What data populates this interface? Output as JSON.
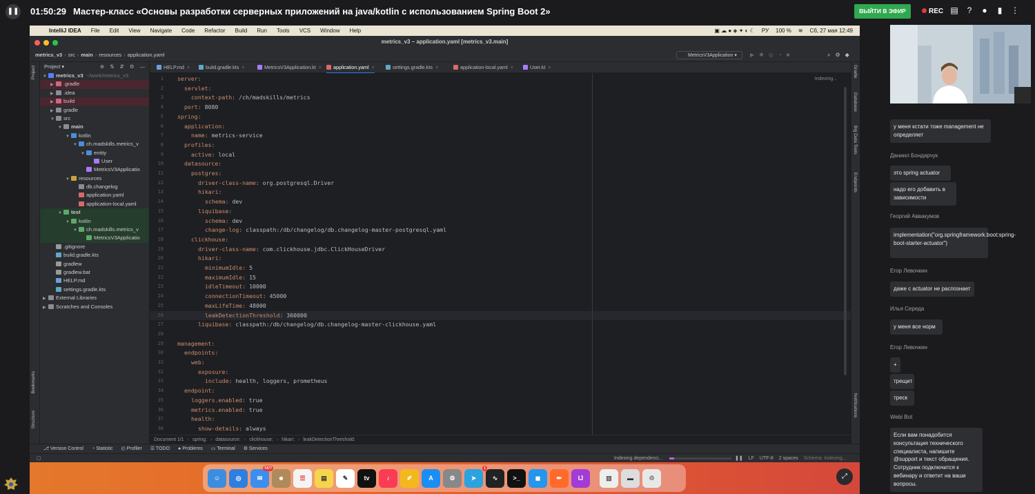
{
  "top_bar": {
    "timer": "01:50:29",
    "title": "Мастер-класс «Основы разработки серверных приложений на java/kotlin с использованием Spring Boot 2»",
    "exit_button": "ВЫЙТИ В ЭФИР",
    "rec_label": "REC",
    "icons": [
      "chat-icon",
      "question-icon",
      "user-icon",
      "document-icon",
      "more-icon"
    ]
  },
  "mac_menu": {
    "items": [
      "IntelliJ IDEA",
      "File",
      "Edit",
      "View",
      "Navigate",
      "Code",
      "Refactor",
      "Build",
      "Run",
      "Tools",
      "VCS",
      "Window",
      "Help"
    ],
    "language": "РУ",
    "battery": "100 %",
    "clock": "Сб, 27 мая  12:49"
  },
  "ide": {
    "window_title": "metrics_v3 – application.yaml [metrics_v3.main]",
    "breadcrumbs": [
      "metrics_v3",
      "src",
      "main",
      "resources",
      "application.yaml"
    ],
    "run_config": "MetricsV3Application",
    "project_panel_title": "Project",
    "tree": [
      {
        "label": "metrics_v3",
        "extra": "~/work/metrics_v3",
        "depth": 0,
        "open": true,
        "bold": true,
        "type": "module"
      },
      {
        "label": ".gradle",
        "depth": 1,
        "open": false,
        "type": "folder-ex"
      },
      {
        "label": ".idea",
        "depth": 1,
        "open": false,
        "type": "folder"
      },
      {
        "label": "build",
        "depth": 1,
        "open": false,
        "type": "folder-ex"
      },
      {
        "label": "gradle",
        "depth": 1,
        "open": false,
        "type": "folder"
      },
      {
        "label": "src",
        "depth": 1,
        "open": true,
        "type": "folder"
      },
      {
        "label": "main",
        "depth": 2,
        "open": true,
        "bold": true,
        "type": "folder"
      },
      {
        "label": "kotlin",
        "depth": 3,
        "open": true,
        "type": "src"
      },
      {
        "label": "ch.madskills.metrics_v",
        "depth": 4,
        "open": true,
        "type": "package"
      },
      {
        "label": "entity",
        "depth": 5,
        "open": true,
        "type": "package"
      },
      {
        "label": "User",
        "depth": 6,
        "type": "kotlin"
      },
      {
        "label": "MetricsV3Applicatio",
        "depth": 5,
        "type": "kotlin"
      },
      {
        "label": "resources",
        "depth": 3,
        "open": true,
        "type": "res"
      },
      {
        "label": "db.changelog",
        "depth": 4,
        "type": "folder"
      },
      {
        "label": "application.yaml",
        "depth": 4,
        "type": "yaml"
      },
      {
        "label": "application-local.yaml",
        "depth": 4,
        "type": "yaml"
      },
      {
        "label": "test",
        "depth": 2,
        "open": true,
        "bold": true,
        "type": "folder-test"
      },
      {
        "label": "kotlin",
        "depth": 3,
        "open": true,
        "type": "test"
      },
      {
        "label": "ch.madskills.metrics_v",
        "depth": 4,
        "open": true,
        "type": "test"
      },
      {
        "label": "MetricsV3Applicatio",
        "depth": 5,
        "type": "test"
      },
      {
        "label": ".gitignore",
        "depth": 1,
        "type": "file"
      },
      {
        "label": "build.gradle.kts",
        "depth": 1,
        "type": "gradle"
      },
      {
        "label": "gradlew",
        "depth": 1,
        "type": "file"
      },
      {
        "label": "gradlew.bat",
        "depth": 1,
        "type": "file"
      },
      {
        "label": "HELP.md",
        "depth": 1,
        "type": "md"
      },
      {
        "label": "settings.gradle.kts",
        "depth": 1,
        "type": "gradle"
      },
      {
        "label": "External Libraries",
        "depth": 0,
        "open": false,
        "type": "lib"
      },
      {
        "label": "Scratches and Consoles",
        "depth": 0,
        "open": false,
        "type": "lib"
      }
    ],
    "tabs": [
      {
        "label": "HELP.md",
        "active": false
      },
      {
        "label": "build.gradle.kts",
        "active": false
      },
      {
        "label": "MetricsV3Application.kt",
        "active": false
      },
      {
        "label": "application.yaml",
        "active": true
      },
      {
        "label": "settings.gradle.kts",
        "active": false
      },
      {
        "label": "application-local.yaml",
        "active": false
      },
      {
        "label": "User.kt",
        "active": false
      }
    ],
    "indexing_label": "Indexing...",
    "caret_line": 26,
    "code": [
      {
        "indent": 0,
        "key": "server:",
        "value": ""
      },
      {
        "indent": 1,
        "key": "servlet:",
        "value": ""
      },
      {
        "indent": 2,
        "key": "context-path:",
        "value": " /ch/madskills/metrics"
      },
      {
        "indent": 1,
        "key": "port:",
        "value": " 8080"
      },
      {
        "indent": 0,
        "key": "spring:",
        "value": ""
      },
      {
        "indent": 1,
        "key": "application:",
        "value": ""
      },
      {
        "indent": 2,
        "key": "name:",
        "value": " metrics-service"
      },
      {
        "indent": 1,
        "key": "profiles:",
        "value": ""
      },
      {
        "indent": 2,
        "key": "active:",
        "value": " local"
      },
      {
        "indent": 1,
        "key": "datasource:",
        "value": ""
      },
      {
        "indent": 2,
        "key": "postgres:",
        "value": ""
      },
      {
        "indent": 3,
        "key": "driver-class-name:",
        "value": " org.postgresql.Driver"
      },
      {
        "indent": 3,
        "key": "hikari:",
        "value": ""
      },
      {
        "indent": 4,
        "key": "schema:",
        "value": " dev"
      },
      {
        "indent": 3,
        "key": "liquibase:",
        "value": ""
      },
      {
        "indent": 4,
        "key": "schema:",
        "value": " dev"
      },
      {
        "indent": 4,
        "key": "change-log:",
        "value": " classpath:/db/changelog/db.changelog-master-postgresql.yaml"
      },
      {
        "indent": 2,
        "key": "clickhouse:",
        "value": ""
      },
      {
        "indent": 3,
        "key": "driver-class-name:",
        "value": " com.clickhouse.jdbc.ClickHouseDriver"
      },
      {
        "indent": 3,
        "key": "hikari:",
        "value": ""
      },
      {
        "indent": 4,
        "key": "minimumIdle:",
        "value": " 5"
      },
      {
        "indent": 4,
        "key": "maximumIdle:",
        "value": " 15"
      },
      {
        "indent": 4,
        "key": "idleTimeout:",
        "value": " 10000"
      },
      {
        "indent": 4,
        "key": "connectionTimeout:",
        "value": " 45000"
      },
      {
        "indent": 4,
        "key": "maxLifeTime:",
        "value": " 48000"
      },
      {
        "indent": 4,
        "key": "leakDetectionThreshold:",
        "value": " 360000"
      },
      {
        "indent": 3,
        "key": "liquibase:",
        "value": " classpath:/db/changelog/db.changelog-master-clickhouse.yaml"
      },
      {
        "indent": 0,
        "key": "",
        "value": ""
      },
      {
        "indent": 0,
        "key": "management:",
        "value": ""
      },
      {
        "indent": 1,
        "key": "endpoints:",
        "value": ""
      },
      {
        "indent": 2,
        "key": "web:",
        "value": ""
      },
      {
        "indent": 3,
        "key": "exposure:",
        "value": ""
      },
      {
        "indent": 4,
        "key": "include:",
        "value": " health, loggers, prometheus"
      },
      {
        "indent": 1,
        "key": "endpoint:",
        "value": ""
      },
      {
        "indent": 2,
        "key": "loggers.enabled:",
        "value": " true"
      },
      {
        "indent": 2,
        "key": "metrics.enabled:",
        "value": " true"
      },
      {
        "indent": 2,
        "key": "health:",
        "value": ""
      },
      {
        "indent": 3,
        "key": "show-details:",
        "value": " always"
      }
    ],
    "editor_breadcrumbs": [
      "Document 1/1",
      "spring:",
      "datasource:",
      "clickhouse:",
      "hikari:",
      "leakDetectionThreshold:"
    ],
    "tool_windows": [
      "Version Control",
      "Statistic",
      "Profiler",
      "TODO",
      "Problems",
      "Terminal",
      "Services"
    ],
    "left_strip": [
      "Project",
      "Bookmarks",
      "Structure"
    ],
    "right_strip": [
      "Gradle",
      "Database",
      "Big Data Tools",
      "Endpoints",
      "Notifications"
    ],
    "status": {
      "indexing": "Indexing dependenci...",
      "progress": 0.08,
      "lf": "LF",
      "encoding": "UTF-8",
      "indent": "2 spaces",
      "schema": "Schema: Indexing..."
    }
  },
  "dock": {
    "mail_badge": "7477",
    "telegram_badge": "1",
    "tv_label": "tv"
  },
  "chat": {
    "messages": [
      {
        "author": "",
        "text": "у меня кстати тоже management не определяет"
      },
      {
        "author": "Даниил Бондарчук",
        "text": "это spring actuator"
      },
      {
        "author": "",
        "text": "надо его добавить в зависимости"
      },
      {
        "author": "Георгий Аввакумов",
        "text": "implementation(\"org.springframework.boot:spring-boot-starter-actuator\")"
      },
      {
        "author": "Егор Левочкин",
        "text": "даже с actuator не распознает"
      },
      {
        "author": "Илья Середа",
        "text": "у меня все норм"
      },
      {
        "author": "Егор Левочкин",
        "text": "+"
      },
      {
        "author": "",
        "text": "трещит"
      },
      {
        "author": "",
        "text": "треск"
      },
      {
        "author": "Webi Bot",
        "text": "Если вам понадобится консультация технического специалиста, напишите @support и текст обращения. Сотрудник подключится к вебинару и ответит на ваши вопросы."
      }
    ]
  }
}
